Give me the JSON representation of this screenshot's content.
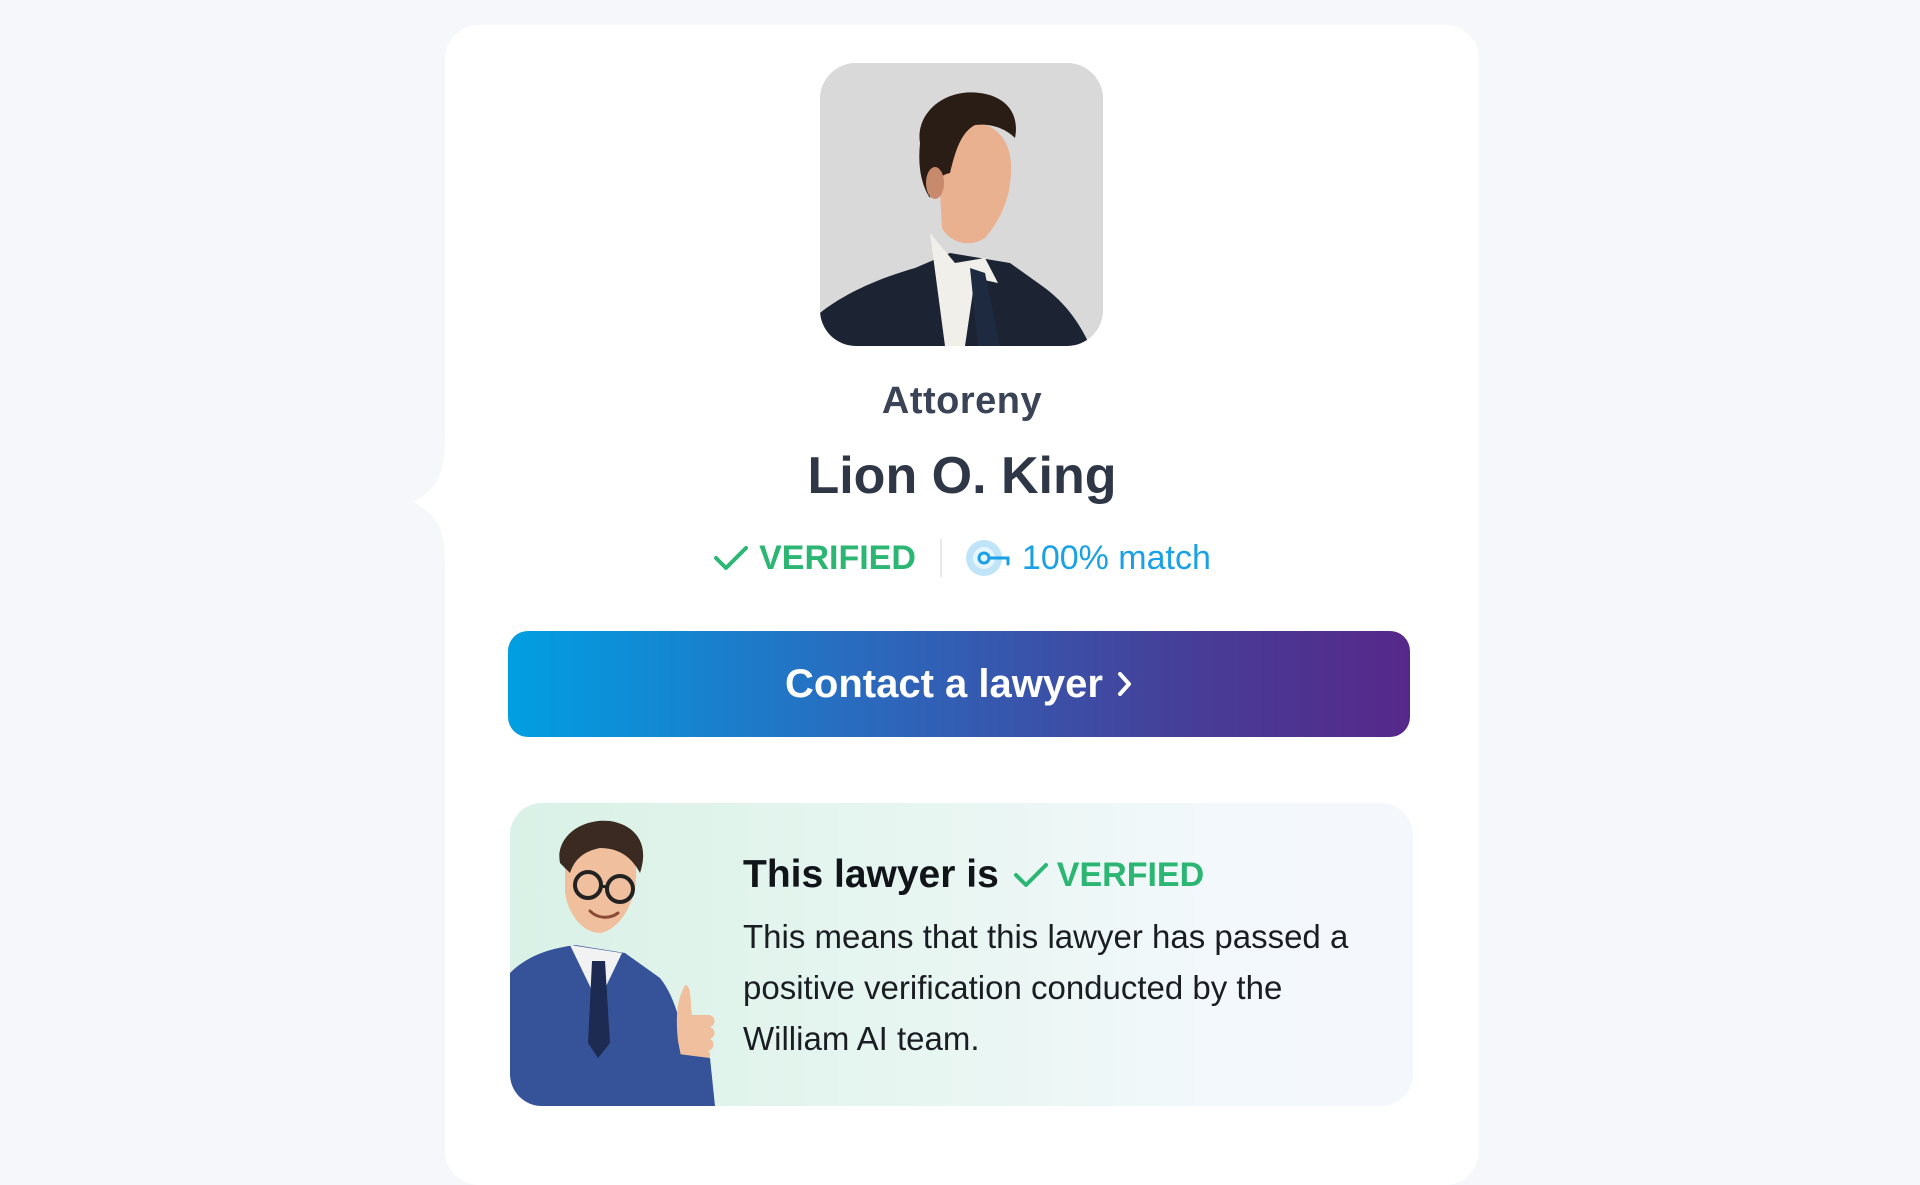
{
  "profile": {
    "role": "Attoreny",
    "name": "Lion O. King",
    "verified_label": "VERIFIED",
    "match_label": "100% match"
  },
  "actions": {
    "contact_label": "Contact a lawyer"
  },
  "verification_info": {
    "title": "This lawyer is",
    "badge_label": "VERFIED",
    "description": "This means that this lawyer has passed a positive verification conducted by the William AI team."
  },
  "colors": {
    "verified_green": "#2bb673",
    "match_blue": "#1aa0e6",
    "button_gradient_start": "#019fe2",
    "button_gradient_end": "#56288a"
  },
  "icons": {
    "verified": "check-icon",
    "match": "match-icon",
    "contact_chevron": "chevron-right-icon"
  }
}
